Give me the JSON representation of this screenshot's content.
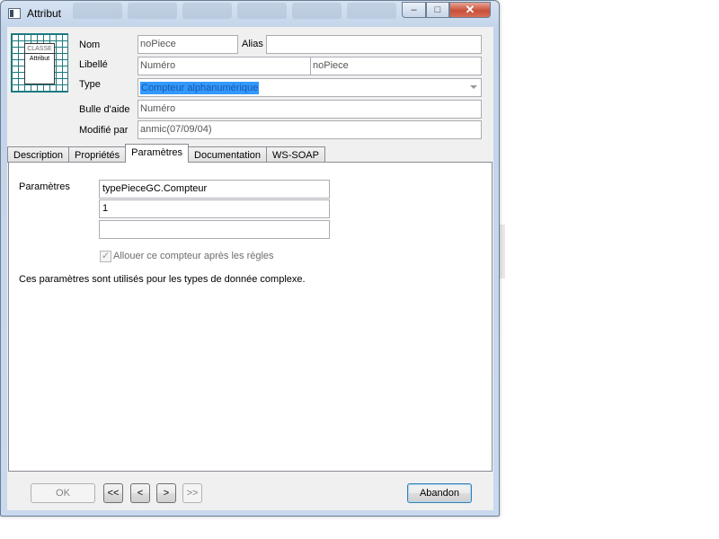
{
  "window": {
    "title": "Attribut"
  },
  "class_icon": {
    "header": "CLASSE",
    "label": "Attribut"
  },
  "form": {
    "nom_label": "Nom",
    "nom_value": "noPiece",
    "alias_label": "Alias",
    "alias_value": "",
    "libelle_label": "Libellé",
    "libelle_value": "Numéro",
    "libelle_value2": "noPiece",
    "type_label": "Type",
    "type_value": "Compteur alphanumérique",
    "bulle_label": "Bulle d'aide",
    "bulle_value": "Numéro",
    "modifie_label": "Modifié par",
    "modifie_value": "anmic(07/09/04)"
  },
  "tabs": [
    {
      "label": "Description"
    },
    {
      "label": "Propriétés"
    },
    {
      "label": "Paramètres"
    },
    {
      "label": "Documentation"
    },
    {
      "label": "WS-SOAP"
    }
  ],
  "params": {
    "label": "Paramètres",
    "values": [
      "typePieceGC.Compteur",
      "1",
      ""
    ],
    "checkbox_label": "Allouer ce compteur après les règles",
    "checkbox_checked": true,
    "note": "Ces paramètres sont utilisés pour les types de donnée complexe."
  },
  "buttons": {
    "ok": "OK",
    "first": "<<",
    "prev": "<",
    "next": ">",
    "last": ">>",
    "cancel": "Abandon"
  }
}
